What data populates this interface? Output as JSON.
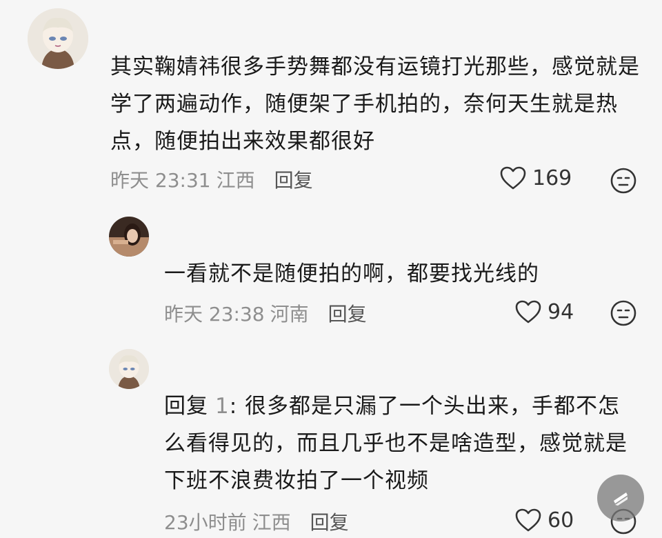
{
  "comments": [
    {
      "text": "其实鞠婧祎很多手势舞都没有运镜打光那些，感觉就是学了两遍动作，随便架了手机拍的，奈何天生就是热点，随便拍出来效果都很好",
      "time": "昨天 23:31",
      "location": "江西",
      "reply_label": "回复",
      "likes": "169"
    },
    {
      "text": "一看就不是随便拍的啊，都要找光线的",
      "time": "昨天 23:38",
      "location": "河南",
      "reply_label": "回复",
      "likes": "94"
    },
    {
      "reply_prefix": "回复",
      "reply_target": "1",
      "text": ": 很多都是只漏了一个头出来，手都不怎么看得见的，而且几乎也不是啥造型，感觉就是下班不浪费妆拍了一个视频",
      "time": "23小时前",
      "location": "江西",
      "reply_label": "回复",
      "likes": "60"
    }
  ],
  "icons": {
    "like": "heart-outline-icon",
    "emoji": "neutral-face-icon",
    "float": "slash-icon"
  },
  "colors": {
    "background": "#f6f6f6",
    "meta_text": "#8e8e8e",
    "main_text": "#1a1a1a"
  }
}
